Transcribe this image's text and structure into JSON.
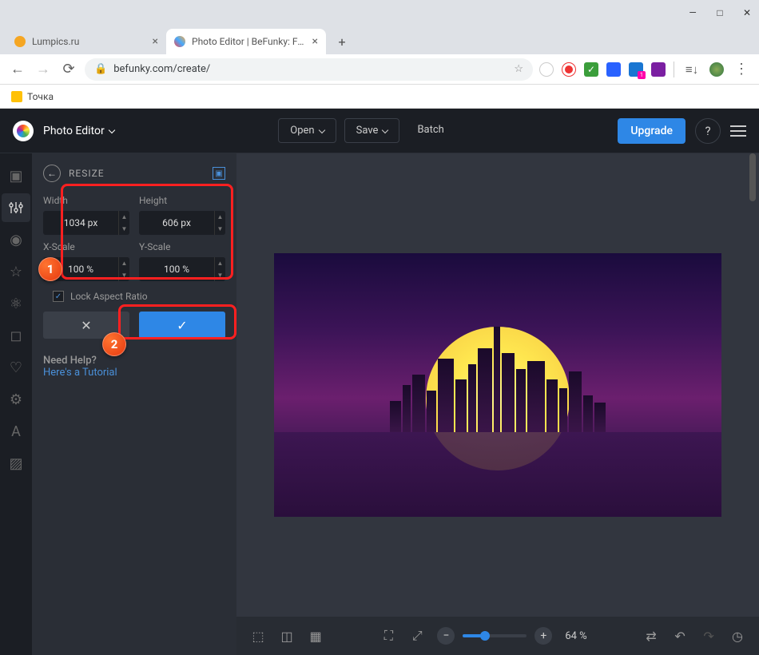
{
  "browser": {
    "tabs": [
      {
        "title": "Lumpics.ru",
        "favicon": "#f5a623"
      },
      {
        "title": "Photo Editor | BeFunky: Free Onl",
        "favicon": "#888"
      }
    ],
    "url": "befunky.com/create/",
    "bookmark": "Точка"
  },
  "header": {
    "mode": "Photo Editor",
    "open": "Open",
    "save": "Save",
    "batch": "Batch",
    "upgrade": "Upgrade"
  },
  "panel": {
    "title": "RESIZE",
    "width_label": "Width",
    "height_label": "Height",
    "xscale_label": "X-Scale",
    "yscale_label": "Y-Scale",
    "width_val": "1034 px",
    "height_val": "606 px",
    "xscale_val": "100 %",
    "yscale_val": "100 %",
    "lock_label": "Lock Aspect Ratio",
    "help_title": "Need Help?",
    "help_link": "Here's a Tutorial"
  },
  "bottom": {
    "zoom": "64 %"
  },
  "annotations": {
    "one": "1",
    "two": "2"
  }
}
